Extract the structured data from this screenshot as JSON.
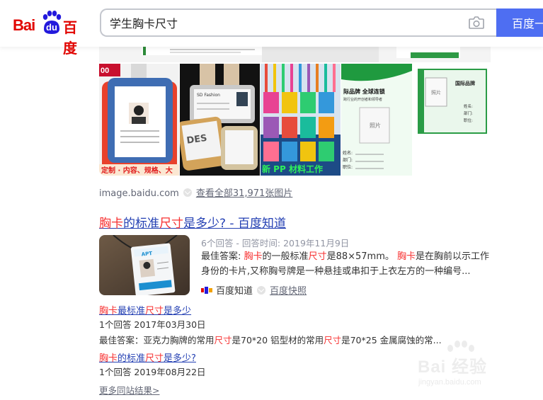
{
  "header": {
    "logo_latin": "Bai",
    "logo_du": "du",
    "logo_cn": "百度",
    "search_value": "学生胸卡尺寸",
    "search_button": "百度一下"
  },
  "images": {
    "source": "image.baidu.com",
    "view_all": "查看全部31,971张图片",
    "thumb2_caption": "SD Fashion",
    "thumb5_title": "际品牌  全球连锁",
    "thumb5_sub": "跨行业的开创者和领导者",
    "thumb5_photo": "照片",
    "thumb5_fields": [
      "姓名:",
      "部门:",
      "职位:"
    ],
    "thumb6_title": "国际品牌",
    "thumb6_photo": "照片",
    "thumb6_fields": [
      "姓名:",
      "部门:",
      "职位:"
    ],
    "thumb4_banner": "新 PP 材料工作",
    "thumb1_banner": "定制 · 内容、规格、大"
  },
  "result": {
    "title_parts": [
      {
        "text": "胸卡",
        "hl": true
      },
      {
        "text": "的标准",
        "hl": false
      },
      {
        "text": "尺寸",
        "hl": true
      },
      {
        "text": "是多少? - 百度知道",
        "hl": false
      }
    ],
    "meta": "6个回答 - 回答时间: 2019年11月9日",
    "abstract_parts": [
      {
        "text": "最佳答案: ",
        "hl": false
      },
      {
        "text": "胸卡",
        "hl": true
      },
      {
        "text": "的一般标准",
        "hl": false
      },
      {
        "text": "尺寸",
        "hl": true
      },
      {
        "text": "是88×57mm。 ",
        "hl": false
      },
      {
        "text": "胸卡",
        "hl": true
      },
      {
        "text": "是在胸前以示工作身份的卡片,又称胸号牌是一种悬挂或串扣于上衣左方的一种编号...",
        "hl": false
      }
    ],
    "source_name": "百度知道",
    "snapshot": "百度快照"
  },
  "related": [
    {
      "title_parts": [
        {
          "text": "胸卡",
          "hl": true
        },
        {
          "text": "最标准",
          "hl": false
        },
        {
          "text": "尺寸",
          "hl": true
        },
        {
          "text": "是多少",
          "hl": false
        }
      ],
      "meta": "1个回答  2017年03月30日",
      "abstract_parts": [
        {
          "text": "最佳答案：亚克力胸牌的常用",
          "hl": false
        },
        {
          "text": "尺寸",
          "hl": true
        },
        {
          "text": "是70*20 铝型材的常用",
          "hl": false
        },
        {
          "text": "尺寸",
          "hl": true
        },
        {
          "text": "是70*25 金属腐蚀的常...",
          "hl": false
        }
      ]
    },
    {
      "title_parts": [
        {
          "text": "胸卡",
          "hl": true
        },
        {
          "text": "的标准",
          "hl": false
        },
        {
          "text": "尺寸",
          "hl": true
        },
        {
          "text": "是多少?",
          "hl": false
        }
      ],
      "meta": "1个回答  2019年08月22日"
    }
  ],
  "more_results": "更多同站结果>",
  "watermark": {
    "text": "Bai 经验",
    "url": "jingyan.baidu.com"
  },
  "colors": {
    "brand_red": "#e10602",
    "brand_blue": "#2319dc",
    "link": "#2440b3",
    "highlight": "#f73131",
    "button": "#4e6ef2"
  }
}
